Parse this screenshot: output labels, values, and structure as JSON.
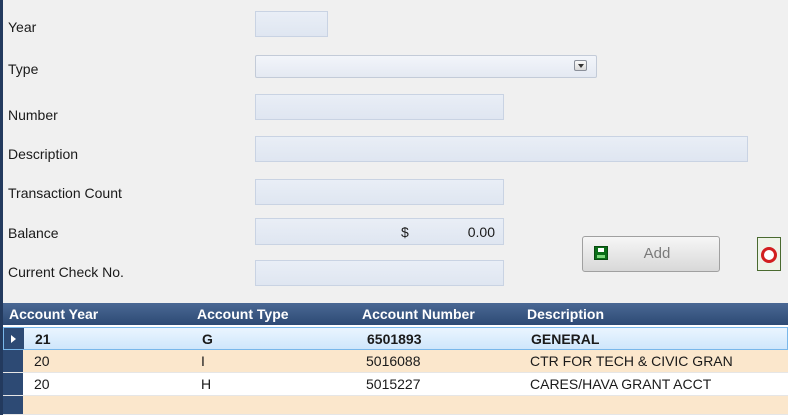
{
  "form": {
    "year_label": "Year",
    "year_value": "",
    "type_label": "Type",
    "type_value": "",
    "number_label": "Number",
    "number_value": "",
    "description_label": "Description",
    "description_value": "",
    "transaction_count_label": "Transaction Count",
    "transaction_count_value": "",
    "balance_label": "Balance",
    "balance_currency": "$",
    "balance_value": "0.00",
    "check_label": "Current Check No.",
    "check_value": ""
  },
  "buttons": {
    "add_label": "Add",
    "add_icon": "save-disk-icon",
    "help_icon": "lifebuoy-icon"
  },
  "grid": {
    "columns": [
      "Account Year",
      "Account Type",
      "Account Number",
      "Description"
    ],
    "rows": [
      {
        "year": "21",
        "type": "G",
        "number": "6501893",
        "description": "GENERAL"
      },
      {
        "year": "20",
        "type": "I",
        "number": "5016088",
        "description": "CTR FOR TECH & CIVIC GRAN"
      },
      {
        "year": "20",
        "type": "H",
        "number": "5015227",
        "description": "CARES/HAVA GRANT ACCT"
      },
      {
        "year": "",
        "type": "",
        "number": "",
        "description": ""
      }
    ],
    "selected_row": 0
  },
  "colors": {
    "header": "#2d4a74",
    "selected_row": "#cfe6fb",
    "alt_row": "#fbe7cc"
  }
}
